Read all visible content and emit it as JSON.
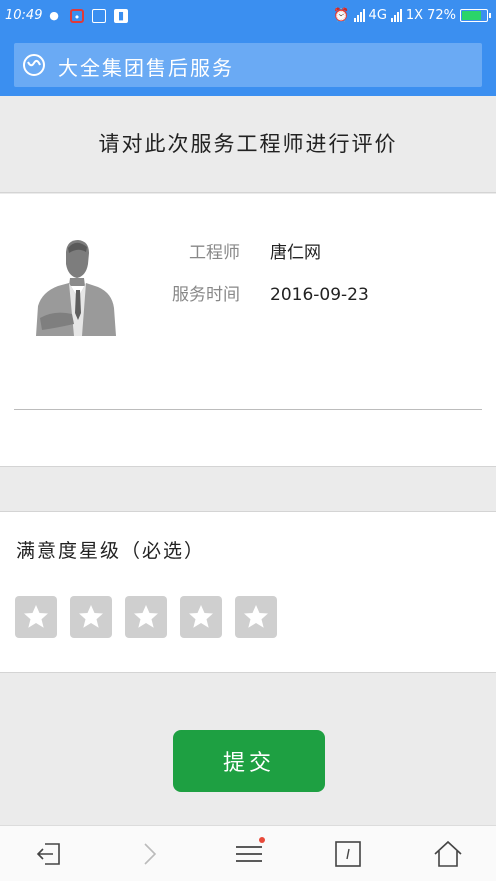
{
  "status_bar": {
    "time": "10:49",
    "network": "4G",
    "network2": "1X",
    "battery_percent": "72%",
    "battery_level": 0.72
  },
  "header": {
    "title": "大全集团售后服务"
  },
  "page": {
    "title": "请对此次服务工程师进行评价"
  },
  "engineer": {
    "label": "工程师",
    "name": "唐仁网",
    "time_label": "服务时间",
    "service_date": "2016-09-23"
  },
  "rating": {
    "label": "满意度星级（必选）",
    "max_stars": 5,
    "selected": 0
  },
  "actions": {
    "submit_label": "提交"
  },
  "colors": {
    "brand_blue": "#3b8ff0",
    "submit_green": "#1ea042",
    "star_inactive": "#cfcfcf"
  },
  "icons": {
    "header": "brand-logo-icon",
    "nav": [
      "back-exit-icon",
      "forward-icon",
      "menu-icon",
      "tabs-icon",
      "home-icon"
    ]
  }
}
